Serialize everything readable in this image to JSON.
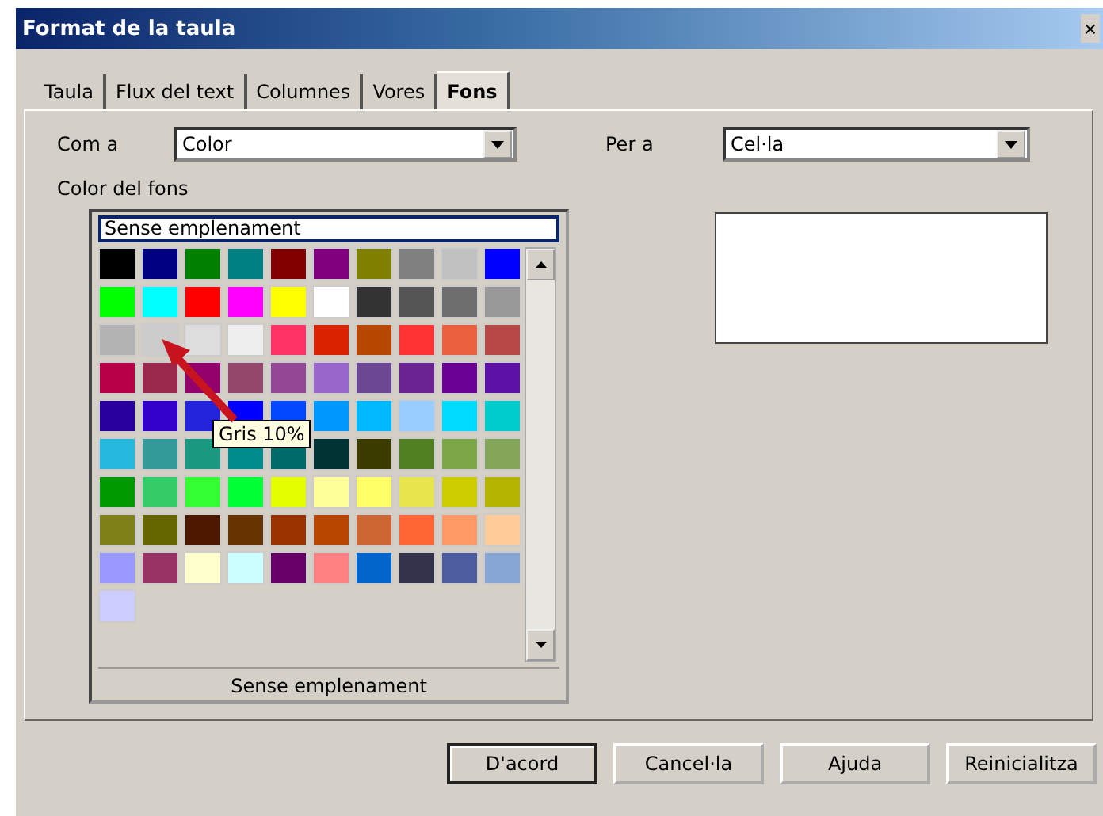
{
  "window": {
    "title": "Format de la taula",
    "close": "×"
  },
  "tabs": [
    {
      "label": "Taula",
      "selected": false
    },
    {
      "label": "Flux del text",
      "selected": false
    },
    {
      "label": "Columnes",
      "selected": false
    },
    {
      "label": "Vores",
      "selected": false
    },
    {
      "label": "Fons",
      "selected": true
    }
  ],
  "as_field": {
    "label": "Com a",
    "value": "Color"
  },
  "for_field": {
    "label": "Per a",
    "value": "Cel·la"
  },
  "group_label": "Color del fons",
  "palette": {
    "header": "Sense emplenament",
    "tooltip": "Gris 10%",
    "footer": "Sense emplenament",
    "swatches": [
      {
        "color": "#000000"
      },
      {
        "color": "#000080"
      },
      {
        "color": "#008000"
      },
      {
        "color": "#008080"
      },
      {
        "color": "#800000"
      },
      {
        "color": "#800080"
      },
      {
        "color": "#808000"
      },
      {
        "color": "#808080"
      },
      {
        "color": "#c0c0c0"
      },
      {
        "color": "#0000ff"
      },
      {
        "color": "#00ff00"
      },
      {
        "color": "#00ffff"
      },
      {
        "color": "#ff0000"
      },
      {
        "color": "#ff00ff"
      },
      {
        "color": "#ffff00"
      },
      {
        "color": "#ffffff"
      },
      {
        "color": "#333333"
      },
      {
        "color": "#555555"
      },
      {
        "color": "#6e6e6e"
      },
      {
        "color": "#999999"
      },
      {
        "color": "#b3b3b3"
      },
      {
        "color": "#cccccc"
      },
      {
        "color": "#dddddd"
      },
      {
        "color": "#eeeeee"
      },
      {
        "color": "#ff3366"
      },
      {
        "color": "#dc2300"
      },
      {
        "color": "#b84700"
      },
      {
        "color": "#ff3333"
      },
      {
        "color": "#eb613d"
      },
      {
        "color": "#b84747"
      },
      {
        "color": "#b80047"
      },
      {
        "color": "#99284c"
      },
      {
        "color": "#94006b"
      },
      {
        "color": "#94476b"
      },
      {
        "color": "#944794"
      },
      {
        "color": "#9966cc"
      },
      {
        "color": "#6b4794"
      },
      {
        "color": "#6b2394"
      },
      {
        "color": "#6b0094"
      },
      {
        "color": "#5e11a6"
      },
      {
        "color": "#28009e"
      },
      {
        "color": "#3300cc"
      },
      {
        "color": "#2323dc"
      },
      {
        "color": "#0000ff"
      },
      {
        "color": "#0047ff"
      },
      {
        "color": "#0099ff"
      },
      {
        "color": "#00b8ff"
      },
      {
        "color": "#99ccff"
      },
      {
        "color": "#00dcff"
      },
      {
        "color": "#00cccc"
      },
      {
        "color": "#23b8dc"
      },
      {
        "color": "#339999"
      },
      {
        "color": "#199980"
      },
      {
        "color": "#008c8c"
      },
      {
        "color": "#006b6b"
      },
      {
        "color": "#003333"
      },
      {
        "color": "#3c3c00"
      },
      {
        "color": "#508022"
      },
      {
        "color": "#7da647"
      },
      {
        "color": "#83a659"
      },
      {
        "color": "#009900"
      },
      {
        "color": "#33cc66"
      },
      {
        "color": "#33ff33"
      },
      {
        "color": "#00ff33"
      },
      {
        "color": "#e6ff00"
      },
      {
        "color": "#ffff99"
      },
      {
        "color": "#ffff66"
      },
      {
        "color": "#e6e64c"
      },
      {
        "color": "#cccc00"
      },
      {
        "color": "#b3b300"
      },
      {
        "color": "#808019"
      },
      {
        "color": "#666600"
      },
      {
        "color": "#4c1900"
      },
      {
        "color": "#663300"
      },
      {
        "color": "#993300"
      },
      {
        "color": "#b84600"
      },
      {
        "color": "#cc6633"
      },
      {
        "color": "#ff6633"
      },
      {
        "color": "#ff9966"
      },
      {
        "color": "#ffcc99"
      },
      {
        "color": "#9999ff"
      },
      {
        "color": "#993366"
      },
      {
        "color": "#ffffcc"
      },
      {
        "color": "#ccffff"
      },
      {
        "color": "#660066"
      },
      {
        "color": "#ff8080"
      },
      {
        "color": "#0066cc"
      },
      {
        "color": "#33334c"
      },
      {
        "color": "#4c5da0"
      },
      {
        "color": "#87a6d3"
      },
      {
        "color": "#ccccff"
      }
    ]
  },
  "buttons": [
    {
      "label": "D'acord",
      "default": true
    },
    {
      "label": "Cancel·la",
      "default": false
    },
    {
      "label": "Ajuda",
      "default": false
    },
    {
      "label": "Reinicialitza",
      "default": false
    }
  ]
}
